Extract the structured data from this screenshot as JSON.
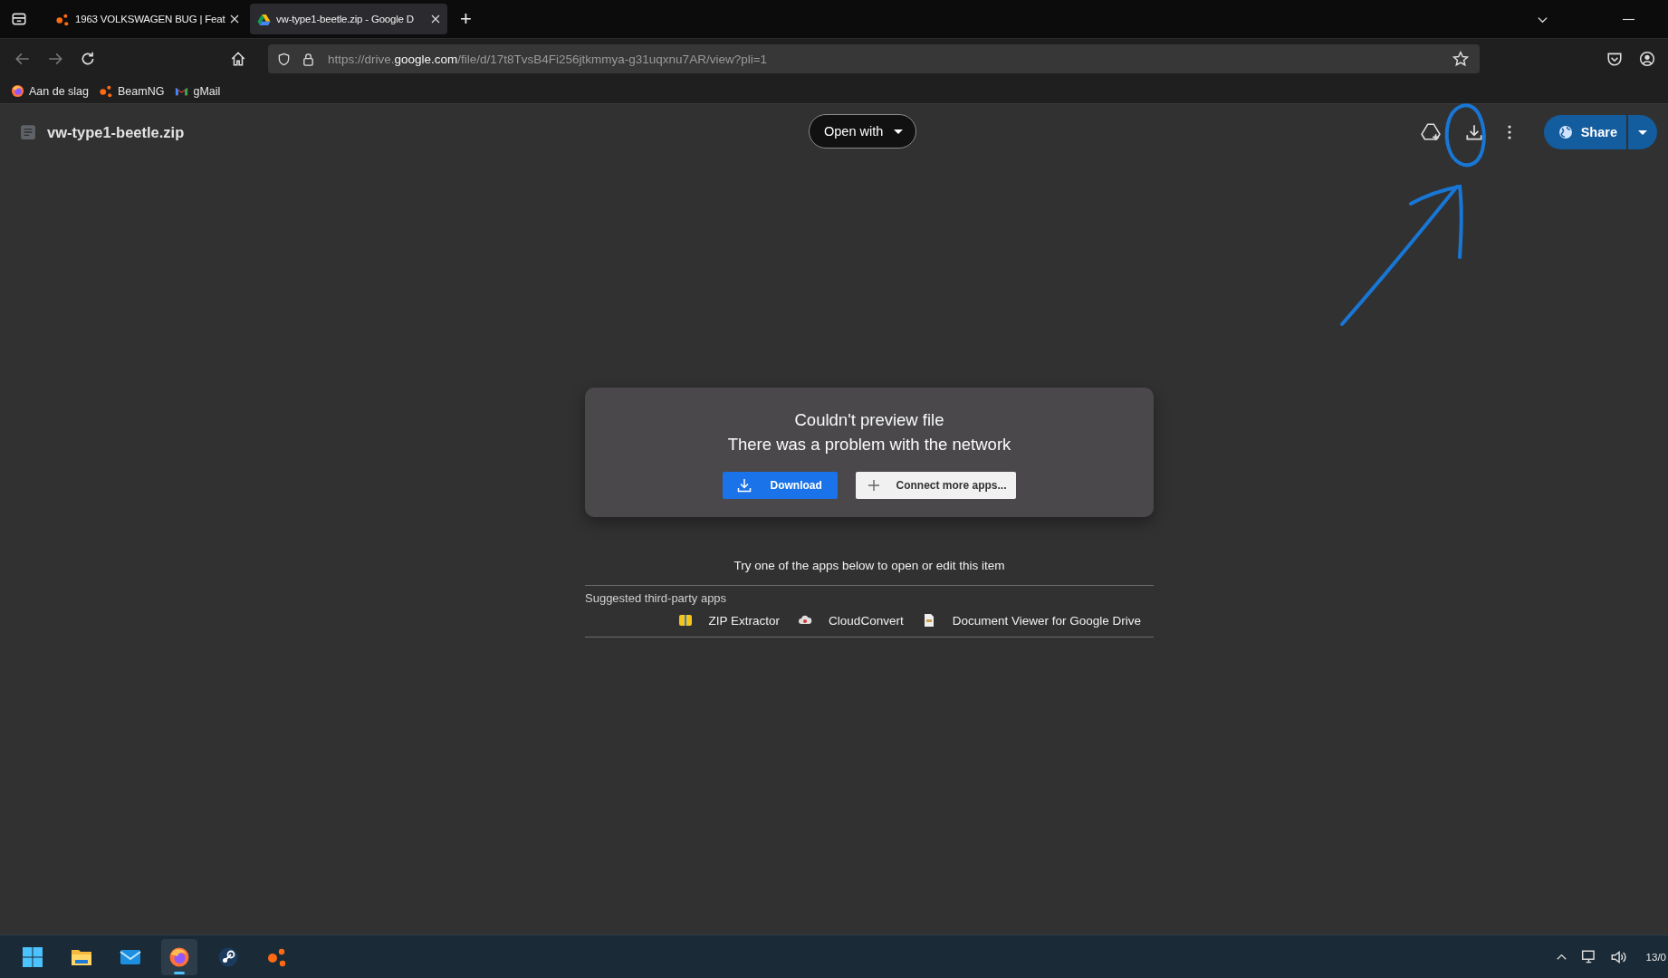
{
  "browser": {
    "tabs": [
      {
        "title": "1963 VOLKSWAGEN BUG | Feat",
        "kind": "beamng",
        "selected": false
      },
      {
        "title": "vw-type1-beetle.zip - Google D",
        "kind": "drive",
        "selected": true
      }
    ],
    "new_tab": "+",
    "url": {
      "prefix": "https://drive.",
      "domain": "google.com",
      "path": "/file/d/17t8TvsB4Fi256jtkmmya-g31uqxnu7AR/view?pli=1"
    },
    "bookmarks": [
      {
        "label": "Aan de slag",
        "kind": "firefox"
      },
      {
        "label": "BeamNG",
        "kind": "beamng"
      },
      {
        "label": "gMail",
        "kind": "gmail"
      }
    ]
  },
  "drive": {
    "file_name": "vw-type1-beetle.zip",
    "open_with": "Open with",
    "share": "Share",
    "dialog": {
      "title": "Couldn't preview file",
      "message": "There was a problem with the network",
      "download": "Download",
      "connect": "Connect more apps..."
    },
    "hint": "Try one of the apps below to open or edit this item",
    "suggested_label": "Suggested third-party apps",
    "apps": [
      {
        "name": "ZIP Extractor",
        "kind": "zip"
      },
      {
        "name": "CloudConvert",
        "kind": "cloud"
      },
      {
        "name": "Document Viewer for Google Drive",
        "kind": "document"
      }
    ]
  },
  "taskbar": {
    "apps": [
      {
        "kind": "start",
        "selected": false
      },
      {
        "kind": "folder",
        "selected": false
      },
      {
        "kind": "mail",
        "selected": false
      },
      {
        "kind": "firefox",
        "selected": true
      },
      {
        "kind": "steam",
        "selected": false
      },
      {
        "kind": "beamng",
        "selected": false
      }
    ],
    "clock": "13/0"
  }
}
